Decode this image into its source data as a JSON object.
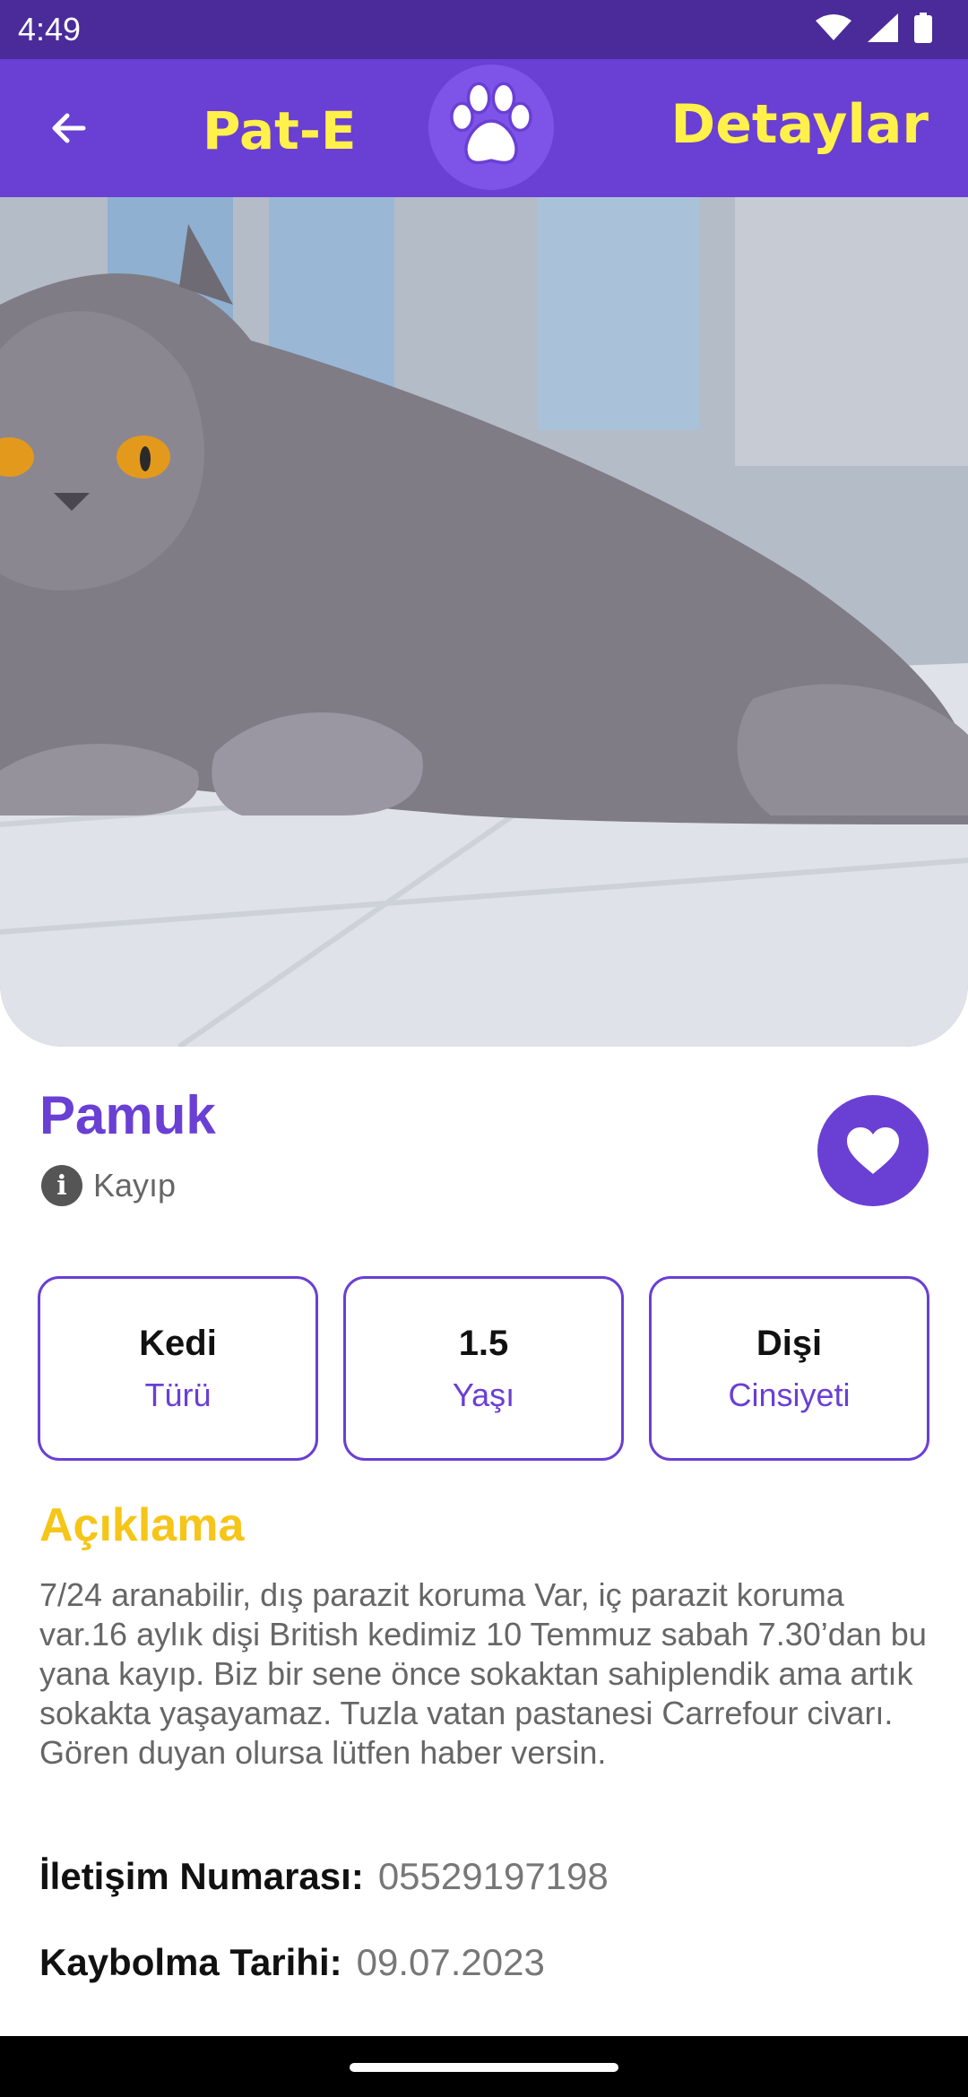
{
  "status_bar": {
    "time": "4:49",
    "icons": [
      "wifi-icon",
      "signal-icon",
      "battery-icon"
    ]
  },
  "app_bar": {
    "back_icon": "arrow-left-icon",
    "app_title": "Pat-E",
    "logo_icon": "paw-icon",
    "page_title": "Detaylar"
  },
  "pet": {
    "photo_subject": "gray-british-shorthair-cat",
    "name": "Pamuk",
    "status_icon": "info-icon",
    "status": "Kayıp",
    "favorite_icon": "heart-icon"
  },
  "stats": [
    {
      "value": "Kedi",
      "label": "Türü"
    },
    {
      "value": "1.5",
      "label": "Yaşı"
    },
    {
      "value": "Dişi",
      "label": "Cinsiyeti"
    }
  ],
  "description": {
    "title": "Açıklama",
    "text": "7/24 aranabilir, dış parazit koruma Var, iç parazit koruma var.16 aylık dişi British kedimiz 10 Temmuz sabah 7.30’dan bu yana kayıp. Biz bir sene önce sokaktan sahiplendik ama artık sokakta yaşayamaz. Tuzla vatan pastanesi Carrefour civarı. Gören duyan olursa lütfen haber versin."
  },
  "contact": {
    "label": "İletişim Numarası:",
    "value": "05529197198"
  },
  "lost_date": {
    "label": "Kaybolma Tarihi:",
    "value": "09.07.2023"
  },
  "colors": {
    "primary": "#6a3fd4",
    "status_bar": "#4a2b99",
    "accent_yellow": "#fff04a",
    "section_title": "#f5c518"
  }
}
